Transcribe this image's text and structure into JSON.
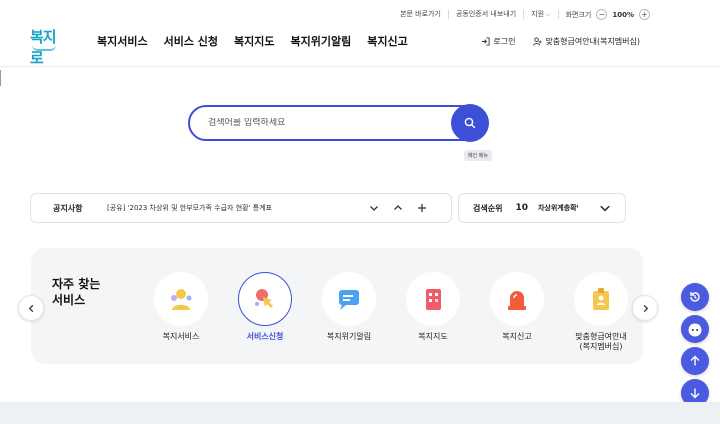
{
  "utility": {
    "skip_to_content": "본문 바로가기",
    "cert_export": "공동인증서 내보내기",
    "region": "지원",
    "zoom_label": "화면크기",
    "zoom_minus": "−",
    "zoom_value": "100%",
    "zoom_plus": "+"
  },
  "header": {
    "logo_text": "복지로",
    "nav": [
      "복지서비스",
      "서비스 신청",
      "복지지도",
      "복지위기알림",
      "복지신고"
    ],
    "login": "로그인",
    "membership": "맞춤형급여안내(복지멤버십)"
  },
  "search": {
    "placeholder": "검색어를 입력하세요",
    "tooltip": "메인 메뉴"
  },
  "notice": {
    "label": "공지사항",
    "text": "[공유] '2023 차상위 및 한부모가족 수급자 현황' 통계표"
  },
  "rank": {
    "label": "검색순위",
    "number": "10",
    "keyword": "차상위계층확인서"
  },
  "frequent": {
    "title": "자주 찾는 서비스",
    "items": [
      {
        "label": "복지서비스",
        "icon": "people-icon"
      },
      {
        "label": "서비스신청",
        "icon": "hand-click-icon"
      },
      {
        "label": "복지위기알림",
        "icon": "chat-bubble-icon"
      },
      {
        "label": "복지지도",
        "icon": "building-icon"
      },
      {
        "label": "복지신고",
        "icon": "siren-icon"
      },
      {
        "label": "맞춤형급여안내\n(복지멤버십)",
        "icon": "id-card-icon"
      }
    ]
  },
  "colors": {
    "accent": "#3d4fd8",
    "logo": "#1aa3c9",
    "panel_bg": "#f4f5f7"
  }
}
